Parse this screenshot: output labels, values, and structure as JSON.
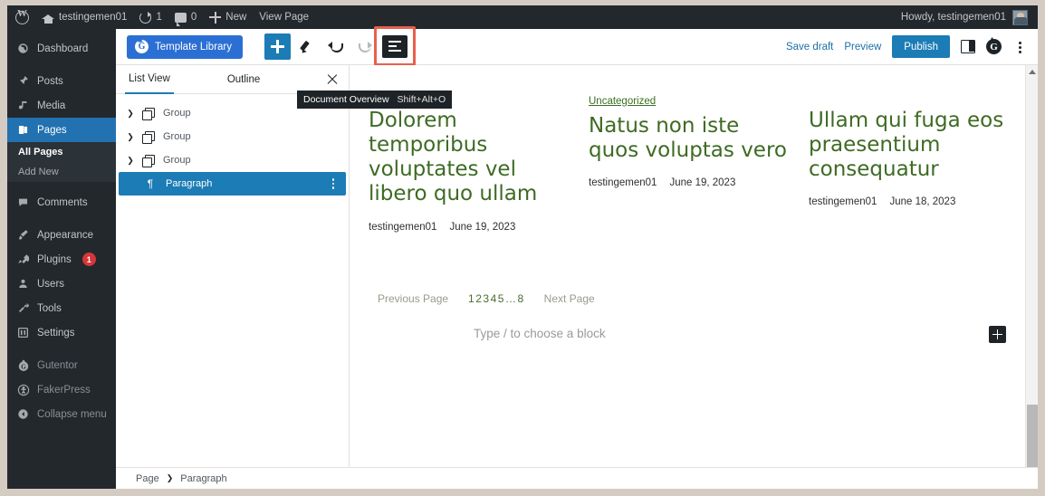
{
  "admin_bar": {
    "wp_logo": "wordpress-logo",
    "site_name": "testingemen01",
    "updates_count": "1",
    "comments_count": "0",
    "new_label": "New",
    "view_page_label": "View Page",
    "howdy": "Howdy, testingemen01"
  },
  "sidebar": {
    "items": [
      {
        "label": "Dashboard",
        "icon": "dashboard-icon"
      },
      {
        "label": "Posts",
        "icon": "pin-icon"
      },
      {
        "label": "Media",
        "icon": "media-icon"
      },
      {
        "label": "Pages",
        "icon": "pages-icon",
        "current": true
      },
      {
        "label": "Comments",
        "icon": "comment-icon"
      },
      {
        "label": "Appearance",
        "icon": "brush-icon"
      },
      {
        "label": "Plugins",
        "icon": "plug-icon",
        "badge": "1"
      },
      {
        "label": "Users",
        "icon": "user-icon"
      },
      {
        "label": "Tools",
        "icon": "wrench-icon"
      },
      {
        "label": "Settings",
        "icon": "settings-icon"
      },
      {
        "label": "Gutentor",
        "icon": "gutentor-icon"
      },
      {
        "label": "FakerPress",
        "icon": "fakerpress-icon"
      },
      {
        "label": "Collapse menu",
        "icon": "collapse-icon"
      }
    ],
    "submenu": [
      {
        "label": "All Pages",
        "active": true
      },
      {
        "label": "Add New",
        "active": false
      }
    ]
  },
  "toolbar": {
    "template_library_label": "Template Library",
    "add_block_label": "+",
    "tools_edit": "pencil-icon",
    "undo": "undo-icon",
    "redo": "redo-icon",
    "document_overview": "document-overview-icon",
    "save_draft_label": "Save draft",
    "preview_label": "Preview",
    "publish_label": "Publish",
    "settings_sidebar": "sidebar-toggle-icon",
    "gutentor_settings": "gutentor-icon",
    "options_menu": "kebab-menu-icon"
  },
  "tooltip": {
    "label": "Document Overview",
    "shortcut": "Shift+Alt+O"
  },
  "list_view": {
    "tabs": [
      {
        "label": "List View",
        "active": true
      },
      {
        "label": "Outline",
        "active": false
      }
    ],
    "close_label": "close-icon",
    "rows": [
      {
        "label": "Group",
        "icon": "group-block-icon",
        "expandable": true,
        "selected": false
      },
      {
        "label": "Group",
        "icon": "group-block-icon",
        "expandable": true,
        "selected": false
      },
      {
        "label": "Group",
        "icon": "group-block-icon",
        "expandable": true,
        "selected": false
      },
      {
        "label": "Paragraph",
        "icon": "paragraph-block-icon",
        "expandable": false,
        "selected": true
      }
    ]
  },
  "canvas": {
    "posts": [
      {
        "category": "",
        "title": "Dolorem temporibus voluptates vel libero quo ullam",
        "author": "testingemen01",
        "date": "June 19, 2023"
      },
      {
        "category": "Uncategorized",
        "title": "Natus non iste quos voluptas vero",
        "author": "testingemen01",
        "date": "June 19, 2023"
      },
      {
        "category": "",
        "title": "Ullam qui fuga eos praesentium consequatur",
        "author": "testingemen01",
        "date": "June 18, 2023"
      }
    ],
    "pagination": {
      "previous_label": "Previous Page",
      "pages": [
        "1",
        "2",
        "3",
        "4",
        "5",
        "…",
        "8"
      ],
      "next_label": "Next Page"
    },
    "empty_paragraph_placeholder": "Type / to choose a block",
    "appender_label": "+"
  },
  "breadcrumb": {
    "items": [
      "Page",
      "Paragraph"
    ],
    "separator": "❯"
  },
  "colors": {
    "wp_admin_dark": "#23282d",
    "wp_blue": "#2271b1",
    "accent_blue": "#1c7cb5",
    "gutentor_blue": "#2b6fd4",
    "post_green": "#3e6b23",
    "highlight_red": "#e8604c",
    "badge_red": "#d63638"
  }
}
